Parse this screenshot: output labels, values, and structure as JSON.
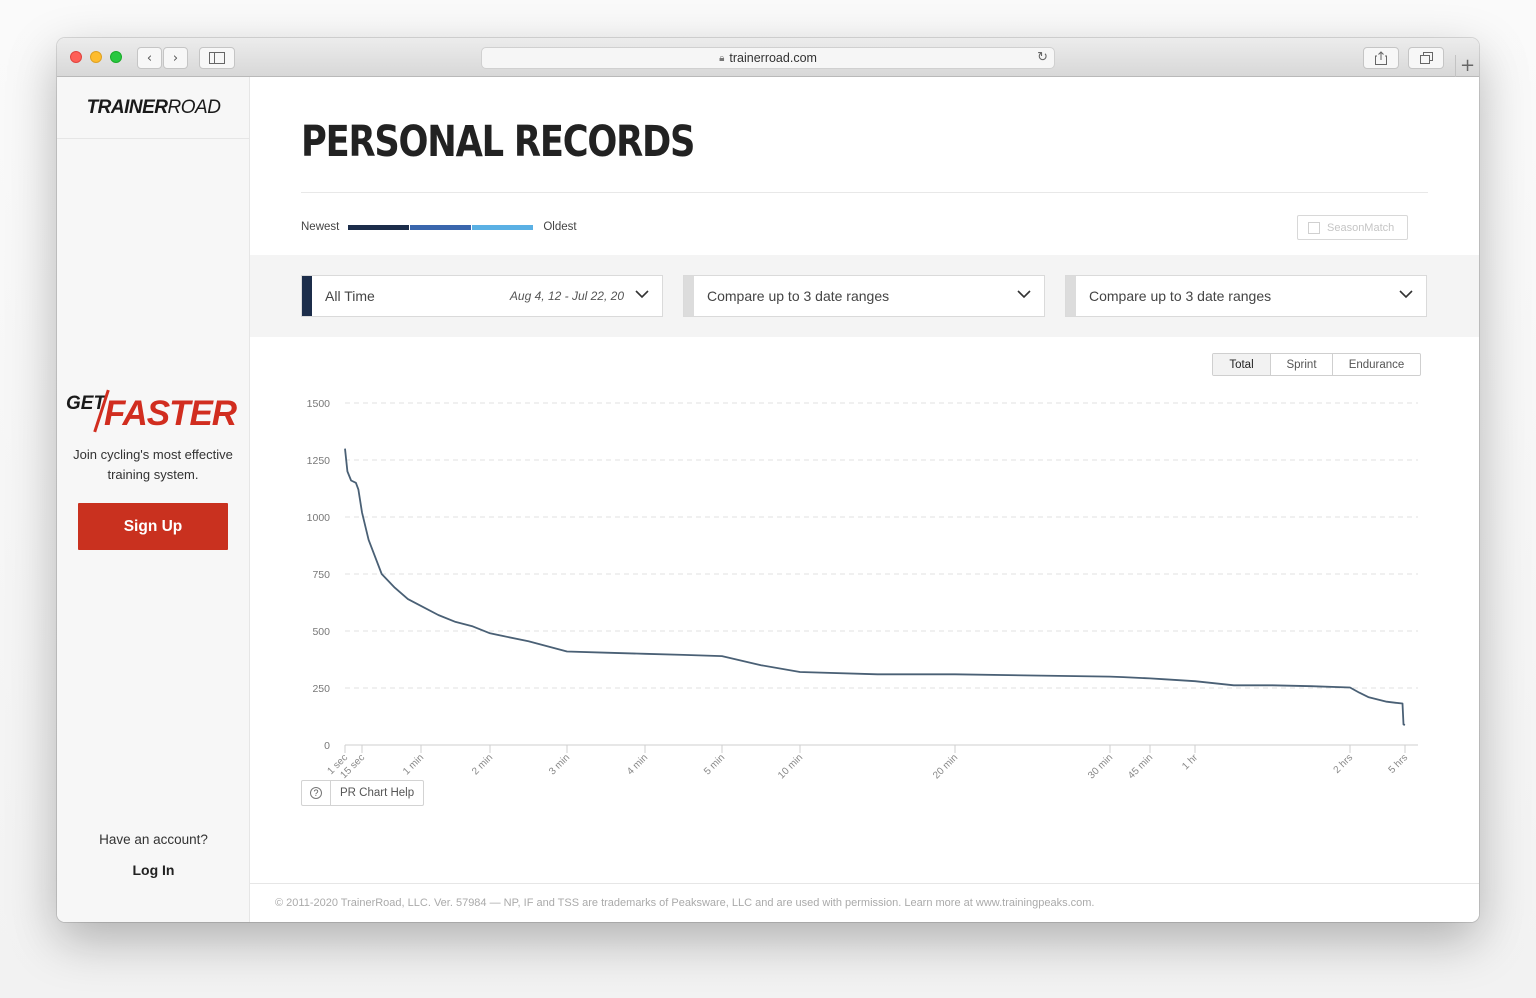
{
  "browser": {
    "url": "trainerroad.com"
  },
  "sidebar": {
    "logo_bold": "TRAINER",
    "logo_light": "ROAD",
    "promo_get": "GET",
    "promo_faster": "FASTER",
    "promo_tagline": "Join cycling's most effective training system.",
    "signup_label": "Sign Up",
    "have_account": "Have an account?",
    "login_label": "Log In"
  },
  "main": {
    "title": "PERSONAL RECORDS",
    "legend_newest": "Newest",
    "legend_oldest": "Oldest",
    "legend_colors": [
      "#1c2d4a",
      "#3a66ad",
      "#5ab0e4"
    ],
    "seasonmatch_label": "SeasonMatch",
    "filters": [
      {
        "label": "All Time",
        "range": "Aug 4, 12 - Jul 22, 20",
        "accent": "#1c2d4a"
      },
      {
        "label": "Compare up to 3 date ranges",
        "range": "",
        "accent": "#dcdcdc"
      },
      {
        "label": "Compare up to 3 date ranges",
        "range": "",
        "accent": "#dcdcdc"
      }
    ],
    "toggle": [
      "Total",
      "Sprint",
      "Endurance"
    ],
    "toggle_active": "Total",
    "help_label": "PR Chart Help",
    "footer": "© 2011-2020 TrainerRoad, LLC. Ver. 57984 — NP, IF and TSS are trademarks of Peaksware, LLC and are used with permission. Learn more at www.trainingpeaks.com."
  },
  "chart_data": {
    "type": "line",
    "title": "",
    "xlabel": "",
    "ylabel": "",
    "ylim": [
      0,
      1500
    ],
    "yticks": [
      0,
      250,
      500,
      750,
      1000,
      1250,
      1500
    ],
    "x_ticks": [
      {
        "label": "1 sec",
        "seconds": 1
      },
      {
        "label": "15 sec",
        "seconds": 15
      },
      {
        "label": "1 min",
        "seconds": 60
      },
      {
        "label": "2 min",
        "seconds": 120
      },
      {
        "label": "3 min",
        "seconds": 180
      },
      {
        "label": "4 min",
        "seconds": 240
      },
      {
        "label": "5 min",
        "seconds": 300
      },
      {
        "label": "10 min",
        "seconds": 600
      },
      {
        "label": "20 min",
        "seconds": 1200
      },
      {
        "label": "30 min",
        "seconds": 1800
      },
      {
        "label": "45 min",
        "seconds": 2700
      },
      {
        "label": "1 hr",
        "seconds": 3600
      },
      {
        "label": "2 hrs",
        "seconds": 7200
      },
      {
        "label": "5 hrs",
        "seconds": 18000
      }
    ],
    "grid": true,
    "line_color": "#4a6075",
    "series": [
      {
        "values": [
          [
            1,
            1300
          ],
          [
            3,
            1200
          ],
          [
            6,
            1160
          ],
          [
            10,
            1150
          ],
          [
            12,
            1120
          ],
          [
            15,
            1020
          ],
          [
            20,
            900
          ],
          [
            30,
            750
          ],
          [
            40,
            690
          ],
          [
            50,
            640
          ],
          [
            60,
            610
          ],
          [
            75,
            570
          ],
          [
            90,
            540
          ],
          [
            105,
            520
          ],
          [
            120,
            490
          ],
          [
            150,
            455
          ],
          [
            180,
            410
          ],
          [
            210,
            405
          ],
          [
            240,
            400
          ],
          [
            270,
            395
          ],
          [
            300,
            390
          ],
          [
            450,
            350
          ],
          [
            600,
            320
          ],
          [
            900,
            310
          ],
          [
            1200,
            310
          ],
          [
            1500,
            305
          ],
          [
            1800,
            300
          ],
          [
            2100,
            298
          ],
          [
            2700,
            292
          ],
          [
            3000,
            288
          ],
          [
            3600,
            280
          ],
          [
            4500,
            262
          ],
          [
            5400,
            262
          ],
          [
            6300,
            258
          ],
          [
            7200,
            252
          ],
          [
            9000,
            230
          ],
          [
            10800,
            210
          ],
          [
            14400,
            190
          ],
          [
            16200,
            185
          ],
          [
            17500,
            182
          ],
          [
            17700,
            90
          ],
          [
            18000,
            88
          ]
        ]
      }
    ]
  }
}
